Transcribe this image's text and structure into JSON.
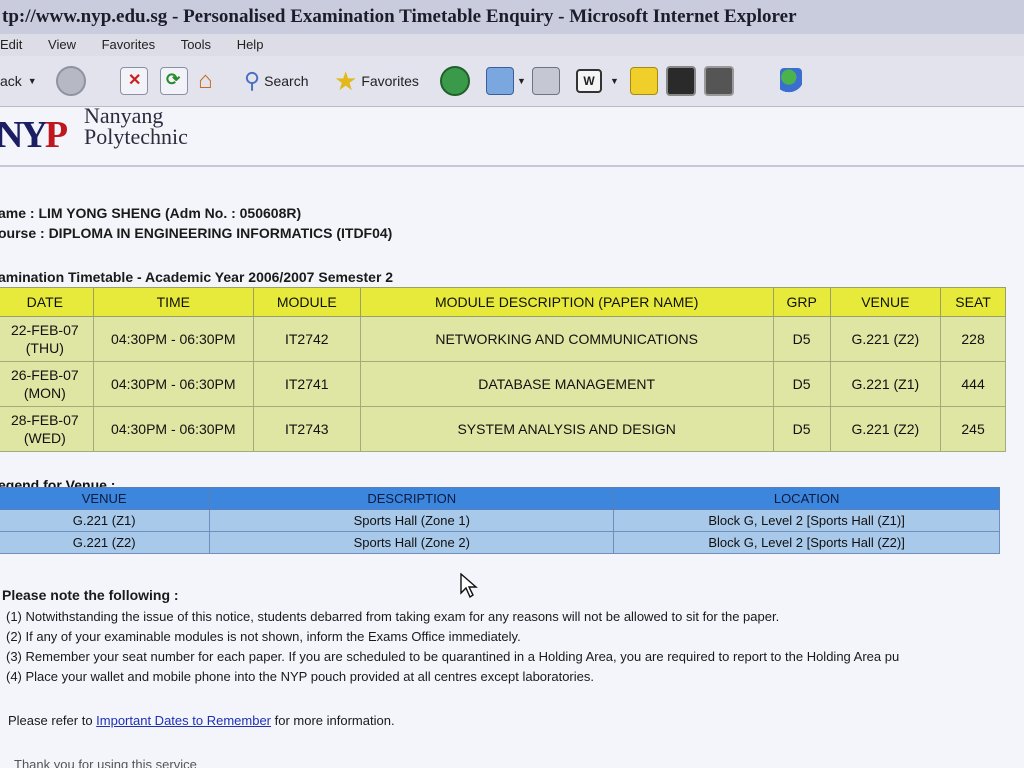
{
  "window": {
    "title": "tp://www.nyp.edu.sg - Personalised Examination Timetable Enquiry - Microsoft Internet Explorer"
  },
  "menu": [
    "Edit",
    "View",
    "Favorites",
    "Tools",
    "Help"
  ],
  "toolbar": {
    "back_label": "ack",
    "search_label": "Search",
    "favorites_label": "Favorites"
  },
  "logo": {
    "line1": "Nanyang",
    "line2": "Polytechnic"
  },
  "student": {
    "name_line": "ame : LIM YONG SHENG (Adm No. : 050608R)",
    "course_line": "ourse : DIPLOMA IN ENGINEERING INFORMATICS (ITDF04)"
  },
  "exam_table": {
    "caption": "amination Timetable - Academic Year 2006/2007 Semester 2",
    "headers": [
      "DATE",
      "TIME",
      "MODULE",
      "MODULE DESCRIPTION (PAPER NAME)",
      "GRP",
      "VENUE",
      "SEAT"
    ],
    "rows": [
      [
        "22-FEB-07 (THU)",
        "04:30PM - 06:30PM",
        "IT2742",
        "NETWORKING AND COMMUNICATIONS",
        "D5",
        "G.221 (Z2)",
        "228"
      ],
      [
        "26-FEB-07 (MON)",
        "04:30PM - 06:30PM",
        "IT2741",
        "DATABASE MANAGEMENT",
        "D5",
        "G.221 (Z1)",
        "444"
      ],
      [
        "28-FEB-07 (WED)",
        "04:30PM - 06:30PM",
        "IT2743",
        "SYSTEM ANALYSIS AND DESIGN",
        "D5",
        "G.221 (Z2)",
        "245"
      ]
    ]
  },
  "venue_legend": {
    "title": "egend for Venue :",
    "headers": [
      "VENUE",
      "DESCRIPTION",
      "LOCATION"
    ],
    "rows": [
      [
        "G.221 (Z1)",
        "Sports Hall (Zone 1)",
        "Block G, Level 2 [Sports Hall (Z1)]"
      ],
      [
        "G.221 (Z2)",
        "Sports Hall (Zone 2)",
        "Block G, Level 2 [Sports Hall (Z2)]"
      ]
    ]
  },
  "notes": {
    "heading": "Please note the following :",
    "items": [
      "(1) Notwithstanding the issue of this notice, students debarred from taking exam for any reasons will not be allowed to sit for the paper.",
      "(2) If any of your examinable modules is not shown, inform the Exams Office immediately.",
      "(3) Remember your seat number for each paper. If you are scheduled to be quarantined in a Holding Area, you are required to report to the Holding Area pu",
      "(4) Place your wallet and mobile phone into the NYP pouch provided at all centres except laboratories."
    ]
  },
  "refer": {
    "prefix": "Please refer to ",
    "link": "Important Dates to Remember",
    "suffix": " for more information."
  },
  "thanks": "Thank you for using this service"
}
